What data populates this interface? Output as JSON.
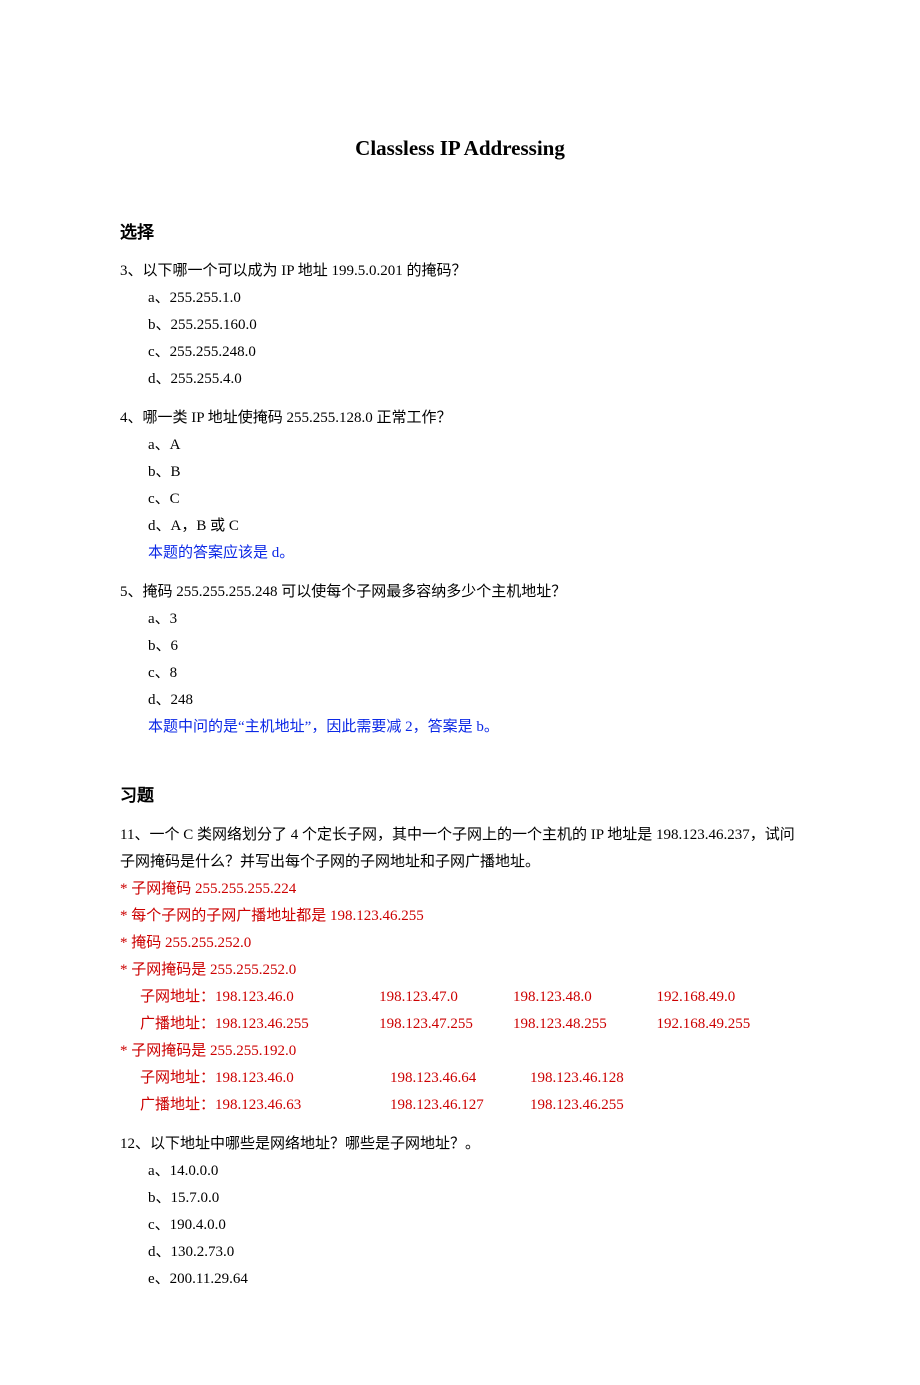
{
  "title": "Classless IP Addressing",
  "sections": {
    "choice_head": "选择",
    "ex_head": "习题"
  },
  "q3": {
    "stem": "3、以下哪一个可以成为 IP 地址 199.5.0.201 的掩码？",
    "a": "a、255.255.1.0",
    "b": "b、255.255.160.0",
    "c": "c、255.255.248.0",
    "d": "d、255.255.4.0"
  },
  "q4": {
    "stem": "4、哪一类 IP 地址使掩码 255.255.128.0 正常工作？",
    "a": "a、A",
    "b": "b、B",
    "c": "c、C",
    "d": "d、A，B 或 C",
    "note": "本题的答案应该是 d。"
  },
  "q5": {
    "stem": "5、掩码 255.255.255.248 可以使每个子网最多容纳多少个主机地址？",
    "a": "a、3",
    "b": "b、6",
    "c": "c、8",
    "d": "d、248",
    "note": "本题中问的是“主机地址”，因此需要减 2，答案是 b。"
  },
  "q11": {
    "stem": "11、一个 C 类网络划分了 4 个定长子网，其中一个子网上的一个主机的 IP 地址是 198.123.46.237，试问子网掩码是什么？并写出每个子网的子网地址和子网广播地址。",
    "l1": "*  子网掩码 255.255.255.224",
    "l2": "*  每个子网的子网广播地址都是 198.123.46.255",
    "l3": "*  掩码 255.255.252.0",
    "l4": "*  子网掩码是 255.255.252.0",
    "t1r1c0": "子网地址：198.123.46.0",
    "t1r1c1": "198.123.47.0",
    "t1r1c2": "198.123.48.0",
    "t1r1c3": "192.168.49.0",
    "t1r2c0": "广播地址：198.123.46.255",
    "t1r2c1": "198.123.47.255",
    "t1r2c2": "198.123.48.255",
    "t1r2c3": "192.168.49.255",
    "l5": "*  子网掩码是 255.255.192.0",
    "t2r1c0": "子网地址：198.123.46.0",
    "t2r1c1": "198.123.46.64",
    "t2r1c2": "198.123.46.128",
    "t2r2c0": "广播地址：198.123.46.63",
    "t2r2c1": "198.123.46.127",
    "t2r2c2": "198.123.46.255"
  },
  "q12": {
    "stem": "12、以下地址中哪些是网络地址？哪些是子网地址？。",
    "a": "a、14.0.0.0",
    "b": "b、15.7.0.0",
    "c": "c、190.4.0.0",
    "d": "d、130.2.73.0",
    "e": "e、200.11.29.64"
  }
}
